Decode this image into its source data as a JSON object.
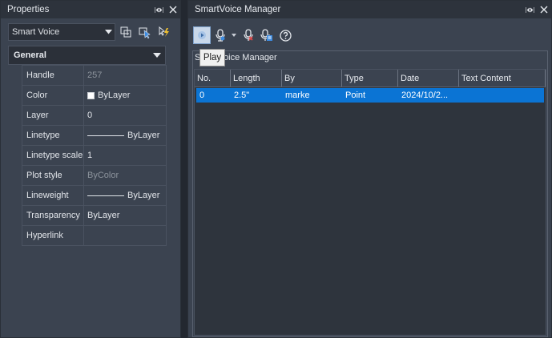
{
  "properties": {
    "title": "Properties",
    "selector_value": "Smart Voice",
    "section": "General",
    "rows": [
      {
        "name": "Handle",
        "value": "257",
        "dim": true,
        "kind": "text"
      },
      {
        "name": "Color",
        "value": "ByLayer",
        "dim": false,
        "kind": "swatch"
      },
      {
        "name": "Layer",
        "value": "0",
        "dim": false,
        "kind": "text"
      },
      {
        "name": "Linetype",
        "value": "ByLayer",
        "dim": false,
        "kind": "line"
      },
      {
        "name": "Linetype scale",
        "value": "1",
        "dim": false,
        "kind": "text"
      },
      {
        "name": "Plot style",
        "value": "ByColor",
        "dim": true,
        "kind": "text"
      },
      {
        "name": "Lineweight",
        "value": "ByLayer",
        "dim": false,
        "kind": "line"
      },
      {
        "name": "Transparency",
        "value": "ByLayer",
        "dim": false,
        "kind": "text"
      },
      {
        "name": "Hyperlink",
        "value": "",
        "dim": false,
        "kind": "text"
      }
    ]
  },
  "smartvoice": {
    "title": "SmartVoice Manager",
    "group_label": "SmartVoice Manager",
    "tooltip": "Play",
    "columns": [
      "No.",
      "Length",
      "By",
      "Type",
      "Date",
      "Text Content"
    ],
    "rows": [
      {
        "no": "0",
        "length": "2.5\"",
        "by": "marke",
        "type": "Point",
        "date": "2024/10/2...",
        "text": ""
      }
    ]
  },
  "colors": {
    "selection": "#0b74d4",
    "panel": "#3b4350",
    "titlebar": "#2d333c"
  }
}
